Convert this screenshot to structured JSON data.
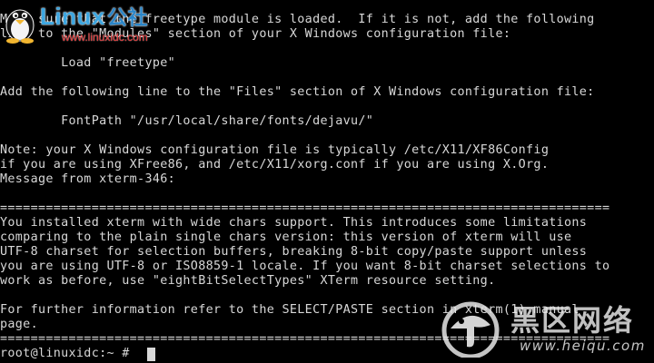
{
  "terminal": {
    "lines": [
      "Make sure that the freetype module is loaded.  If it is not, add the following",
      "line to the \"Modules\" section of your X Windows configuration file:",
      "",
      "        Load \"freetype\"",
      "",
      "Add the following line to the \"Files\" section of X Windows configuration file:",
      "",
      "        FontPath \"/usr/local/share/fonts/dejavu/\"",
      "",
      "Note: your X Windows configuration file is typically /etc/X11/XF86Config",
      "if you are using XFree86, and /etc/X11/xorg.conf if you are using X.Org.",
      "Message from xterm-346:",
      "",
      "================================================================================",
      "You installed xterm with wide chars support. This introduces some limitations",
      "comparing to the plain single chars version: this version of xterm will use",
      "UTF-8 charset for selection buffers, breaking 8-bit copy/paste support unless",
      "you are using UTF-8 or ISO8859-1 locale. If you want 8-bit charset selections to",
      "work as before, use \"eightBitSelectTypes\" XTerm resource setting.",
      "",
      "For further information refer to the SELECT/PASTE section in xterm(1) manual",
      "page.",
      "================================================================================",
      "root@linuxidc:~ # "
    ],
    "colors": {
      "background": "#000000",
      "text": "#d8d8d8"
    }
  },
  "watermarks": {
    "top_left": {
      "brand": "Linux",
      "brand_cn": "公社",
      "url": "www.linuxidc.com"
    },
    "bottom_right": {
      "cn": "黑区网络",
      "domain": "www.heiqu.com"
    }
  }
}
